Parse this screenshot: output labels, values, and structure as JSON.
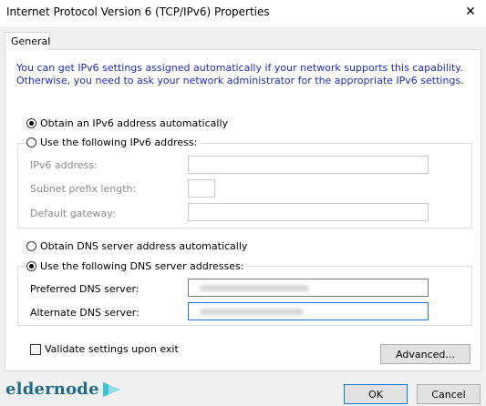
{
  "window": {
    "title": "Internet Protocol Version 6 (TCP/IPv6) Properties",
    "close_symbol": "✕"
  },
  "tabs": [
    {
      "label": "General",
      "selected": true
    }
  ],
  "intro": {
    "line1": "You can get IPv6 settings assigned automatically if your network supports this capability.",
    "line2": "Otherwise, you need to ask your network administrator for the appropriate IPv6 settings."
  },
  "ip": {
    "auto_label": "Obtain an IPv6 address automatically",
    "manual_label": "Use the following IPv6 address:",
    "selected": "auto",
    "address_label": "IPv6 address:",
    "address_value": "",
    "prefix_label": "Subnet prefix length:",
    "prefix_value": "",
    "gateway_label": "Default gateway:",
    "gateway_value": ""
  },
  "dns": {
    "auto_label": "Obtain DNS server address automatically",
    "manual_label": "Use the following DNS server addresses:",
    "selected": "manual",
    "preferred_label": "Preferred DNS server:",
    "alternate_label": "Alternate DNS server:"
  },
  "validate": {
    "label": "Validate settings upon exit",
    "checked": false
  },
  "buttons": {
    "advanced": "Advanced...",
    "ok": "OK",
    "cancel": "Cancel"
  },
  "brand": {
    "name": "eldernode",
    "icon": "play-arrow-logo",
    "color": "#1f6b87"
  },
  "colors": {
    "intro_text": "#1c2bbd",
    "focus_border": "#1a73e8",
    "dialog_bg": "#f0f0f0"
  }
}
